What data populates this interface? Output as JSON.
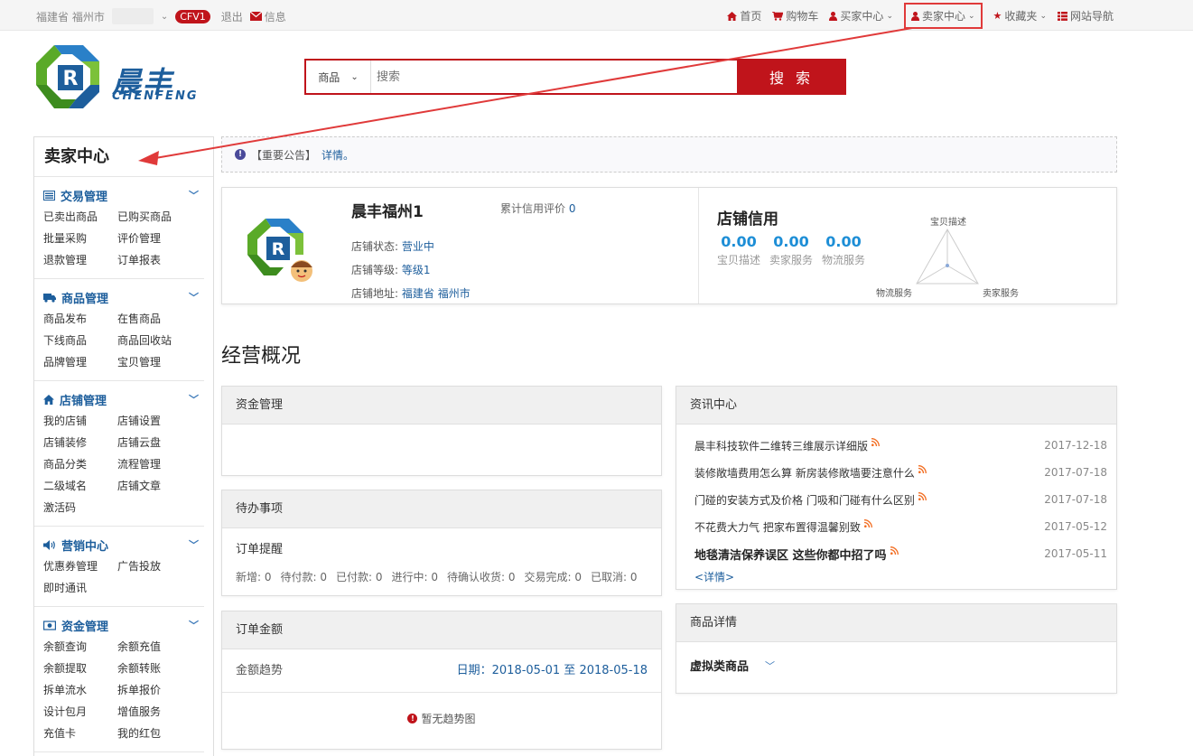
{
  "topbar": {
    "location": "福建省 福州市",
    "badge": "CFV1",
    "logout": "退出",
    "messages": "信息",
    "nav": [
      {
        "label": "首页",
        "icon": "home-icon"
      },
      {
        "label": "购物车",
        "icon": "cart-icon"
      },
      {
        "label": "买家中心",
        "icon": "user-icon"
      },
      {
        "label": "卖家中心",
        "icon": "user-icon"
      },
      {
        "label": "收藏夹",
        "icon": "star-icon"
      },
      {
        "label": "网站导航",
        "icon": "list-icon"
      }
    ]
  },
  "logo": {
    "text": "晨丰",
    "sub": "CHENFENG"
  },
  "search": {
    "category": "商品",
    "placeholder": "搜索",
    "button": "搜 索"
  },
  "sidebar": {
    "title": "卖家中心",
    "sections": [
      {
        "title": "交易管理",
        "icon": "list-icon",
        "links": [
          "已卖出商品",
          "已购买商品",
          "批量采购",
          "评价管理",
          "退款管理",
          "订单报表"
        ]
      },
      {
        "title": "商品管理",
        "icon": "truck-icon",
        "links": [
          "商品发布",
          "在售商品",
          "下线商品",
          "商品回收站",
          "品牌管理",
          "宝贝管理"
        ]
      },
      {
        "title": "店铺管理",
        "icon": "home-icon",
        "links": [
          "我的店铺",
          "店铺设置",
          "店铺装修",
          "店铺云盘",
          "商品分类",
          "流程管理",
          "二级域名",
          "店铺文章",
          "激活码"
        ]
      },
      {
        "title": "营销中心",
        "icon": "volume-icon",
        "links": [
          "优惠券管理",
          "广告投放",
          "即时通讯"
        ]
      },
      {
        "title": "资金管理",
        "icon": "money-icon",
        "links": [
          "余额查询",
          "余额充值",
          "余额提取",
          "余额转账",
          "拆单流水",
          "拆单报价",
          "设计包月",
          "增值服务",
          "充值卡",
          "我的红包"
        ]
      }
    ]
  },
  "notice": {
    "text": "【重要公告】",
    "link": "详情。"
  },
  "store": {
    "name": "晨丰福州1",
    "credit_label": "累计信用评价",
    "credit_value": "0",
    "status_label": "店铺状态:",
    "status_value": "营业中",
    "level_label": "店铺等级:",
    "level_value": "等级1",
    "address_label": "店铺地址:",
    "address_value": "福建省 福州市",
    "rating_title": "店铺信用",
    "scores": [
      {
        "value": "0.00",
        "label": "宝贝描述"
      },
      {
        "value": "0.00",
        "label": "卖家服务"
      },
      {
        "value": "0.00",
        "label": "物流服务"
      }
    ],
    "radar_labels": {
      "top": "宝贝描述",
      "left": "物流服务",
      "right": "卖家服务"
    }
  },
  "overview_title": "经营概况",
  "funds": {
    "title": "资金管理"
  },
  "todo": {
    "title": "待办事项",
    "subtitle": "订单提醒",
    "stats": [
      "新增: 0",
      "待付款: 0",
      "已付款: 0",
      "进行中: 0",
      "待确认收货: 0",
      "交易完成: 0",
      "已取消: 0"
    ]
  },
  "orders": {
    "title": "订单金额",
    "trend_label": "金额趋势",
    "date_label": "日期：2018-05-01 至 2018-05-18",
    "empty": "暂无趋势图"
  },
  "news": {
    "title": "资讯中心",
    "items": [
      {
        "title": "晨丰科技软件二维转三维展示详细版",
        "date": "2017-12-18",
        "bold": false
      },
      {
        "title": "装修敞墙费用怎么算 新房装修敞墙要注意什么",
        "date": "2017-07-18",
        "bold": false
      },
      {
        "title": "门碰的安装方式及价格 门吸和门碰有什么区别",
        "date": "2017-07-18",
        "bold": false
      },
      {
        "title": "不花费大力气 把家布置得温馨别致",
        "date": "2017-05-12",
        "bold": false
      },
      {
        "title": "地毯清洁保养误区 这些你都中招了吗",
        "date": "2017-05-11",
        "bold": true
      }
    ],
    "more": "<详情>"
  },
  "goods": {
    "title": "商品详情",
    "selected": "虚拟类商品"
  },
  "colors": {
    "brand_red": "#c0141b",
    "link_blue": "#1d5e9c",
    "score_blue": "#1d8ed6"
  }
}
